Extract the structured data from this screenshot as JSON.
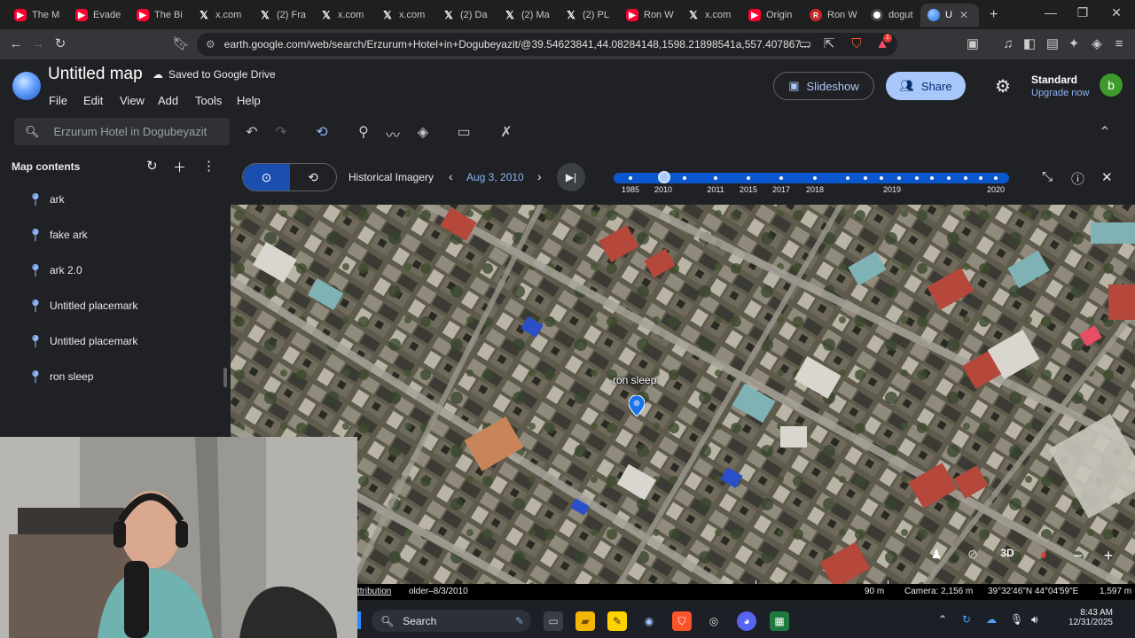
{
  "browser": {
    "tabs": [
      {
        "title": "The M",
        "icon": "youtube-icon"
      },
      {
        "title": "Evade",
        "icon": "youtube-icon"
      },
      {
        "title": "The Bi",
        "icon": "youtube-icon"
      },
      {
        "title": "x.com",
        "icon": "x-icon"
      },
      {
        "title": "(2) Fra",
        "icon": "x-icon"
      },
      {
        "title": "x.com",
        "icon": "x-icon"
      },
      {
        "title": "x.com",
        "icon": "x-icon"
      },
      {
        "title": "(2) Da",
        "icon": "x-icon"
      },
      {
        "title": "(2) Ma",
        "icon": "x-icon"
      },
      {
        "title": "(2) PL",
        "icon": "x-icon"
      },
      {
        "title": "Ron W",
        "icon": "youtube-icon"
      },
      {
        "title": "x.com",
        "icon": "x-icon"
      },
      {
        "title": "Origin",
        "icon": "youtube-icon"
      },
      {
        "title": "Ron W",
        "icon": "ron-icon"
      },
      {
        "title": "dogut",
        "icon": "ge-icon"
      },
      {
        "title": "U",
        "icon": "earth-icon",
        "active": true
      }
    ],
    "new_tab": "+",
    "url": "earth.google.com/web/search/Erzurum+Hotel+in+Dogubeyazit/@39.54623841,44.08284148,1598.21898541a,557.407867...",
    "notification_badge": "1"
  },
  "app": {
    "title": "Untitled map",
    "saved_status": "Saved to Google Drive",
    "menu": [
      "File",
      "Edit",
      "View",
      "Add",
      "Tools",
      "Help"
    ],
    "slideshow_label": "Slideshow",
    "share_label": "Share",
    "plan_name": "Standard",
    "plan_upgrade": "Upgrade now",
    "avatar_letter": "b",
    "search_placeholder": "Erzurum Hotel in Dogubeyazit"
  },
  "sidebar": {
    "title": "Map contents",
    "items": [
      {
        "label": "ark"
      },
      {
        "label": "fake ark"
      },
      {
        "label": "ark 2.0"
      },
      {
        "label": "Untitled placemark"
      },
      {
        "label": "Untitled placemark"
      },
      {
        "label": "ron sleep"
      }
    ]
  },
  "historical": {
    "label": "Historical Imagery",
    "date": "Aug 3, 2010",
    "years": [
      "1985",
      "2010",
      "2011",
      "2015",
      "2017",
      "2018",
      "2019",
      "2020"
    ],
    "selected_year": "2010"
  },
  "map": {
    "placemark_label": "ron sleep",
    "mode_3d": "3D",
    "scale": "90 m",
    "attribution": "ttribution",
    "imagery_date": "older–8/3/2010",
    "camera": "Camera: 2,156 m",
    "coordinates": "39°32'46\"N 44°04'59\"E",
    "elevation": "1,597 m"
  },
  "taskbar": {
    "search_label": "Search",
    "time": "8:43 AM",
    "date": "12/31/2025"
  },
  "colors": {
    "accent": "#8ab4f8",
    "share_bg": "#a8c7fa",
    "timeline": "#0b57d0"
  }
}
